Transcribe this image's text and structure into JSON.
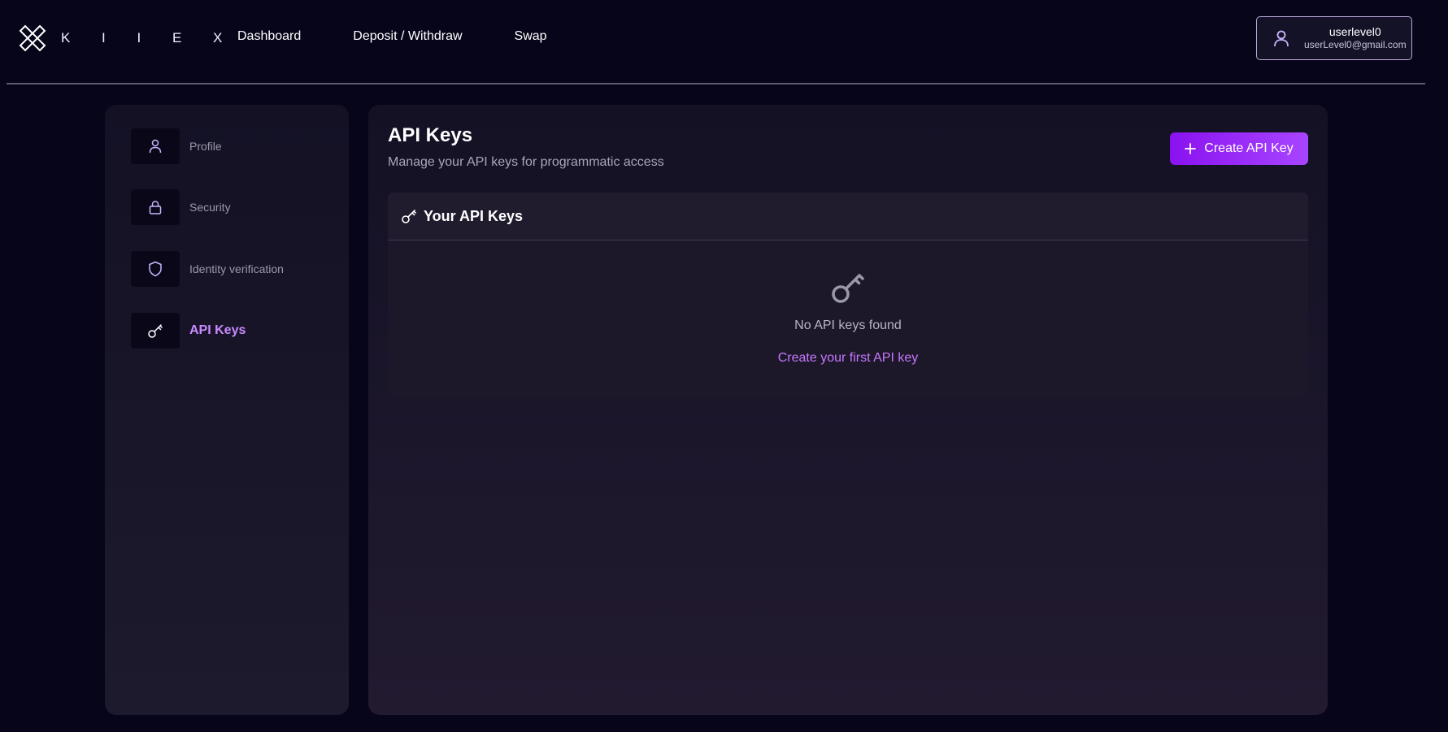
{
  "brand": {
    "name": "K I I E X"
  },
  "nav": {
    "items": [
      {
        "label": "Dashboard"
      },
      {
        "label": "Deposit / Withdraw"
      },
      {
        "label": "Swap"
      }
    ]
  },
  "user": {
    "username": "userlevel0",
    "email": "userLevel0@gmail.com",
    "icon": "user-icon"
  },
  "sidebar": {
    "items": [
      {
        "label": "Profile",
        "icon": "user-icon",
        "active": false
      },
      {
        "label": "Security",
        "icon": "lock-icon",
        "active": false
      },
      {
        "label": "Identity verification",
        "icon": "shield-icon",
        "active": false
      },
      {
        "label": "API Keys",
        "icon": "key-icon",
        "active": true
      }
    ]
  },
  "main": {
    "title": "API Keys",
    "subtitle": "Manage your API keys for programmatic access",
    "create_button_label": "Create API Key",
    "card": {
      "title": "Your API Keys",
      "empty_text": "No API keys found",
      "empty_link": "Create your first API key"
    }
  },
  "colors": {
    "background": "#07051a",
    "accent": "#a845ff",
    "active_label": "#c98bff",
    "link": "#c678ff"
  }
}
